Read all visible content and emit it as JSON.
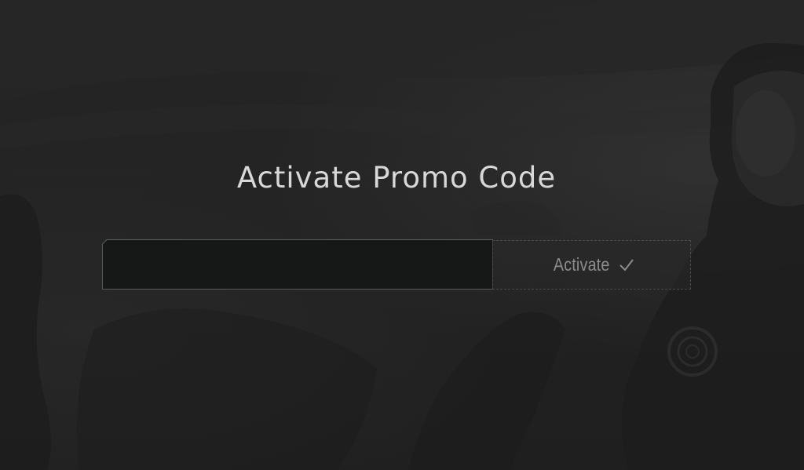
{
  "promo": {
    "title": "Activate Promo Code",
    "code_value": "",
    "code_placeholder": "",
    "activate_label": "Activate",
    "activate_icon": "checkmark-icon"
  },
  "colors": {
    "background": "#222222",
    "title_text": "#d8d8d8",
    "input_background": "#161717",
    "input_border": "#5b5b5b",
    "button_text": "#8c8c8c"
  }
}
